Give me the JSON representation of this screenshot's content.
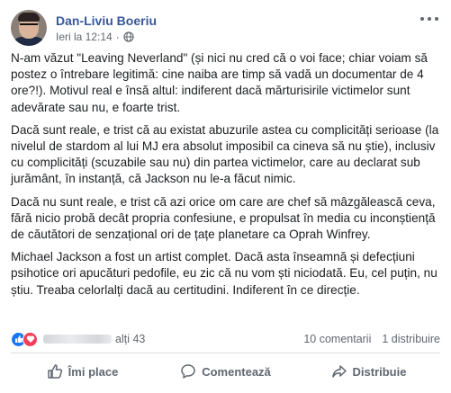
{
  "header": {
    "author": "Dan-Liviu Boeriu",
    "time": "Ieri la 12:14",
    "separator": "·",
    "privacy_icon": "globe-icon"
  },
  "post": {
    "paragraphs": [
      "N-am văzut \"Leaving Neverland\" (și nici nu cred că o voi face; chiar voiam să postez o întrebare legitimă: cine naiba are timp să vadă un documentar de 4 ore?!). Motivul real e însă altul: indiferent dacă mărturisirile victimelor sunt adevărate sau nu, e foarte trist.",
      "Dacă sunt reale, e trist că au existat abuzurile astea cu complicități serioase (la nivelul de stardom al lui MJ era absolut imposibil ca cineva să nu știe), inclusiv cu complicități (scuzabile sau nu) din partea victimelor, care au declarat sub jurământ, în instanță, că Jackson nu le-a făcut nimic.",
      "Dacă nu sunt reale, e trist că azi orice om care are chef să mâzgălească ceva, fără nicio probă decât propria confesiune, e propulsat în media cu inconștiență de căutători de senzațional ori de țațe planetare ca Oprah Winfrey.",
      "Michael Jackson a fost un artist complet. Dacă asta înseamnă și defecțiuni psihotice ori apucături pedofile, eu zic că nu vom ști niciodată. Eu, cel puțin, nu știu. Treaba celorlalți dacă au certitudini. Indiferent în ce direcție."
    ]
  },
  "stats": {
    "reaction_icons": [
      "like-icon",
      "love-icon"
    ],
    "others": "alți 43",
    "comments": "10 comentarii",
    "shares": "1 distribuire"
  },
  "actions": {
    "like": "Îmi place",
    "comment": "Comentează",
    "share": "Distribuie"
  },
  "colors": {
    "name": "#385898",
    "like": "#1877f2",
    "love": "#f33e58",
    "muted": "#606770"
  }
}
